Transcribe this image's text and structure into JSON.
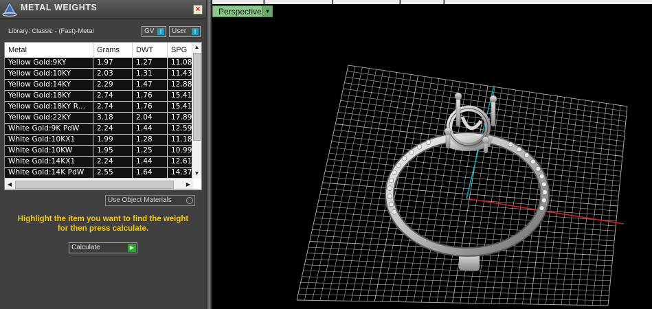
{
  "panel": {
    "title": "METAL WEIGHTS",
    "close_label": "×",
    "library_label": "Library: Classic - (Fast)-Metal",
    "toggles": {
      "gv_label": "GV",
      "user_label": "User"
    },
    "table": {
      "columns": [
        "Metal",
        "Grams",
        "DWT",
        "SPG"
      ],
      "rows": [
        [
          "Yellow Gold:9KY",
          "1.97",
          "1.27",
          "11.08"
        ],
        [
          "Yellow Gold:10KY",
          "2.03",
          "1.31",
          "11.43"
        ],
        [
          "Yellow Gold:14KY",
          "2.29",
          "1.47",
          "12.88"
        ],
        [
          "Yellow Gold:18KY",
          "2.74",
          "1.76",
          "15.41"
        ],
        [
          "Yellow Gold:18KY R...",
          "2.74",
          "1.76",
          "15.41"
        ],
        [
          "Yellow Gold:22KY",
          "3.18",
          "2.04",
          "17.89"
        ],
        [
          "White Gold:9K PdW",
          "2.24",
          "1.44",
          "12.59"
        ],
        [
          "White Gold:10KX1",
          "1.99",
          "1.28",
          "11.18"
        ],
        [
          "White Gold:10KW",
          "1.95",
          "1.25",
          "10.99"
        ],
        [
          "White Gold:14KX1",
          "2.24",
          "1.44",
          "12.61"
        ],
        [
          "White Gold:14K PdW",
          "2.55",
          "1.64",
          "14.37"
        ]
      ]
    },
    "use_object_materials_label": "Use Object Materials",
    "instruction_line1": "Highlight the item you want to find the weight",
    "instruction_line2": "for then press calculate.",
    "calculate_label": "Calculate"
  },
  "viewport": {
    "view_mode": "Perspective",
    "axis_colors": {
      "x": "#d42020",
      "y": "#10a8b8"
    },
    "grid_color": "#b4b4b4",
    "object": "ring-model"
  }
}
